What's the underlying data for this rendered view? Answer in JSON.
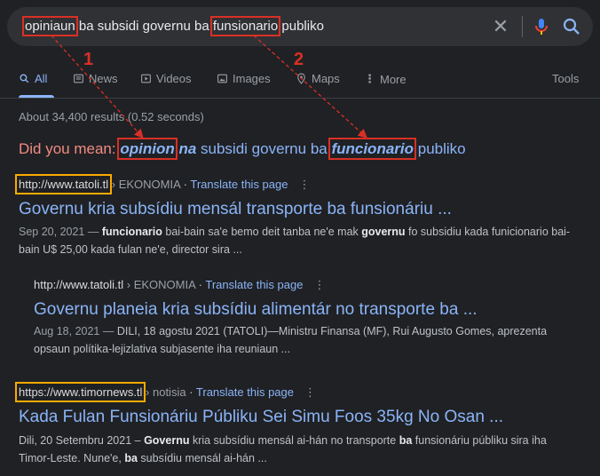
{
  "search": {
    "q1": "opiniaun",
    "q2": " ba subsidi governu ba ",
    "q3": "funsionario",
    "q4": " publiko"
  },
  "tabs": [
    {
      "label": "All",
      "icon": "search-icon"
    },
    {
      "label": "News",
      "icon": "newspaper-icon"
    },
    {
      "label": "Videos",
      "icon": "play-icon"
    },
    {
      "label": "Images",
      "icon": "image-icon"
    },
    {
      "label": "Maps",
      "icon": "map-pin-icon"
    },
    {
      "label": "More",
      "icon": "more-vert-icon"
    }
  ],
  "tools_label": "Tools",
  "stats": "About 34,400 results (0.52 seconds)",
  "did_you_mean": {
    "prefix": "Did you mean: ",
    "c1": "opinion",
    "c2": "na",
    "mid": " subsidi governu ba ",
    "c3": "funcionario",
    "suffix": " publiko"
  },
  "annotations": {
    "a1": "1",
    "a2": "2"
  },
  "results": [
    {
      "site": "http://www.tatoli.tl",
      "crumb": " › EKONOMIA",
      "translate": "Translate this page",
      "title": "Governu kria subsídiu mensál transporte ba funsionáriu ...",
      "s_date": "Sep 20, 2021 — ",
      "s_b1": "funcionario",
      "s_t1": " bai-bain sa'e bemo deit tanba ne'e mak ",
      "s_b2": "governu",
      "s_t2": " fo subsidiu kada funicionario bai-bain U$ 25,00 kada fulan ne'e, director sira ..."
    },
    {
      "site": "http://www.tatoli.tl",
      "crumb": " › EKONOMIA",
      "translate": "Translate this page",
      "title": "Governu planeia kria subsídiu alimentár no transporte ba ...",
      "s_date": "Aug 18, 2021 — ",
      "s_t1": "DILI, 18 agostu 2021 (TATOLI)—Ministru Finansa (MF), Rui Augusto Gomes, aprezenta opsaun polítika-lejizlativa subjasente iha reuniaun ..."
    },
    {
      "site": "https://www.timornews.tl",
      "crumb": " › notisia",
      "translate": "Translate this page",
      "title": "Kada Fulan Funsionáriu Públiku Sei Simu Foos 35kg No Osan ...",
      "s_t0": "Dili, 20 Setembru 2021 – ",
      "s_b1": "Governu",
      "s_t1": " kria subsídiu mensál ai-hán no transporte ",
      "s_b2": "ba",
      "s_t2": " funsionáriu públiku sira iha Timor-Leste. Nune'e, ",
      "s_b3": "ba",
      "s_t3": " subsídiu mensál ai-hán ..."
    }
  ]
}
